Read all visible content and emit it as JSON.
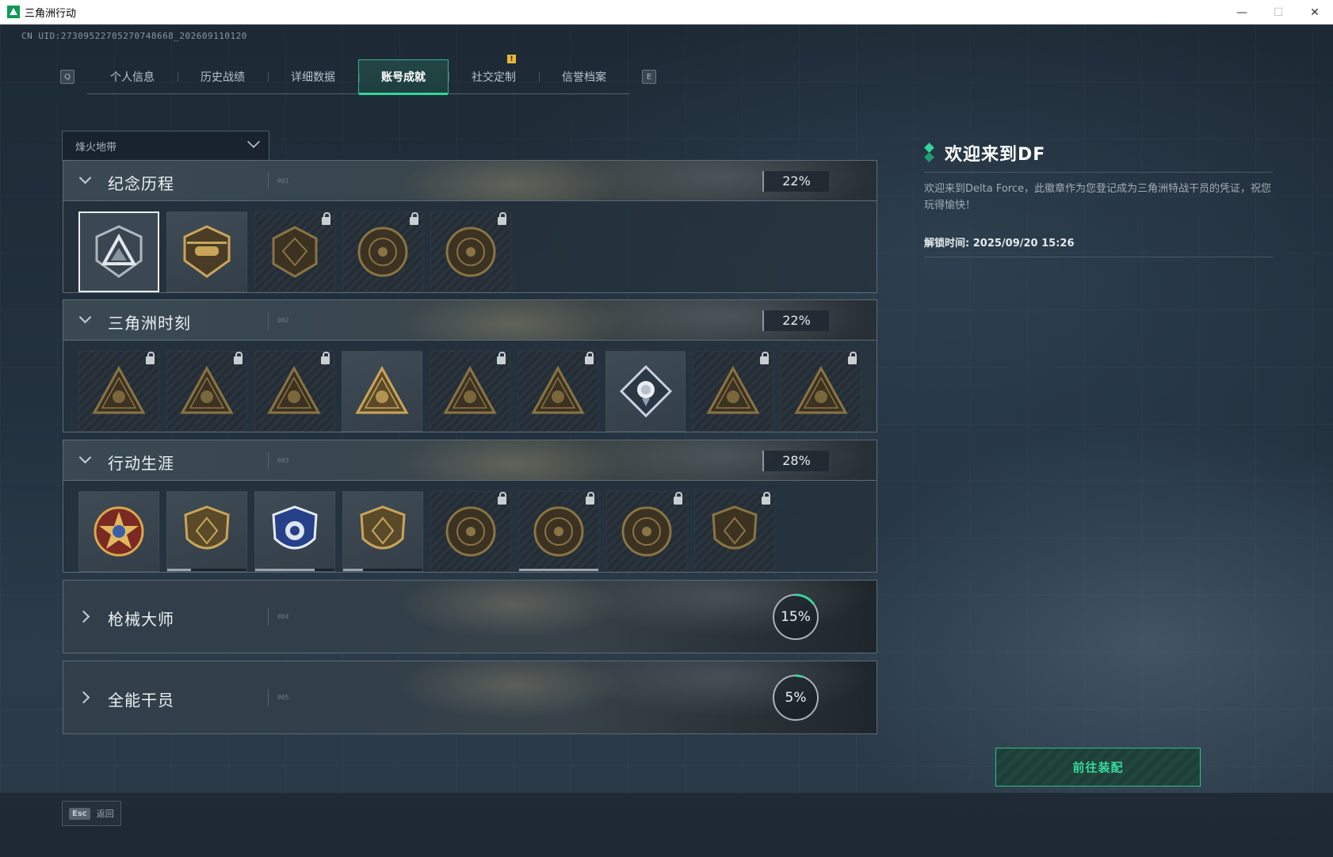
{
  "window": {
    "title": "三角洲行动",
    "minimize": "—",
    "maximize": "☐",
    "close": "✕"
  },
  "uid": "CN UID:27309522705270748668_202609110120",
  "tabs": {
    "left_key": "Q",
    "right_key": "E",
    "items": [
      {
        "label": "个人信息"
      },
      {
        "label": "历史战绩"
      },
      {
        "label": "详细数据"
      },
      {
        "label": "账号成就",
        "active": true
      },
      {
        "label": "社交定制",
        "alert": "!"
      },
      {
        "label": "信誉档案"
      }
    ]
  },
  "mode_select": {
    "value": "烽火地带"
  },
  "sections": [
    {
      "title": "纪念历程",
      "code": "001",
      "percent": "22%",
      "expanded": true,
      "badges": [
        {
          "icon": "delta-emblem-icon",
          "locked": false,
          "selected": true
        },
        {
          "icon": "helicopter-emblem-icon",
          "locked": false
        },
        {
          "icon": "hex-emblem-icon",
          "locked": true
        },
        {
          "icon": "anniversary-emblem-icon",
          "locked": true
        },
        {
          "icon": "year-2025-emblem-icon",
          "locked": true
        }
      ]
    },
    {
      "title": "三角洲时刻",
      "code": "002",
      "percent": "22%",
      "expanded": true,
      "badges": [
        {
          "icon": "triangle-figure-icon",
          "locked": true
        },
        {
          "icon": "triangle-runner-icon",
          "locked": true
        },
        {
          "icon": "triangle-heart-icon",
          "locked": true
        },
        {
          "icon": "triangle-squad-icon",
          "locked": false
        },
        {
          "icon": "triangle-crowd-icon",
          "locked": true
        },
        {
          "icon": "triangle-dolphin-icon",
          "locked": true
        },
        {
          "icon": "rose-diamond-icon",
          "locked": false
        },
        {
          "icon": "triangle-wings-icon",
          "locked": true
        },
        {
          "icon": "triangle-skull-icon",
          "locked": true
        }
      ]
    },
    {
      "title": "行动生涯",
      "code": "003",
      "percent": "28%",
      "expanded": true,
      "badges": [
        {
          "icon": "star-medal-icon",
          "locked": false
        },
        {
          "icon": "shield-chevron-icon",
          "locked": false,
          "progress": 0.3
        },
        {
          "icon": "police-shield-icon",
          "locked": false,
          "progress": 0.75
        },
        {
          "icon": "gem-shield-icon",
          "locked": false,
          "progress": 0.25
        },
        {
          "icon": "round-emblem-icon",
          "locked": true
        },
        {
          "icon": "skull-crosshair-icon",
          "locked": true,
          "progress": 1.0
        },
        {
          "icon": "eye-emblem-icon",
          "locked": true
        },
        {
          "icon": "beast-shield-icon",
          "locked": true
        }
      ]
    },
    {
      "title": "枪械大师",
      "code": "004",
      "percent": "15%",
      "progress": 0.15,
      "expanded": false
    },
    {
      "title": "全能干员",
      "code": "005",
      "percent": "5%",
      "progress": 0.05,
      "expanded": false
    }
  ],
  "info": {
    "title": "欢迎来到DF",
    "description": "欢迎来到Delta Force，此徽章作为您登记成为三角洲特战干员的凭证，祝您玩得愉快！",
    "unlock_time": "解锁时间: 2025/09/20 15:26"
  },
  "equip_button": "前往装配",
  "back": {
    "key": "Esc",
    "label": "返回"
  },
  "colors": {
    "accent": "#35d49b",
    "alert": "#e8b73a",
    "panel_border": "#5e6a74"
  }
}
